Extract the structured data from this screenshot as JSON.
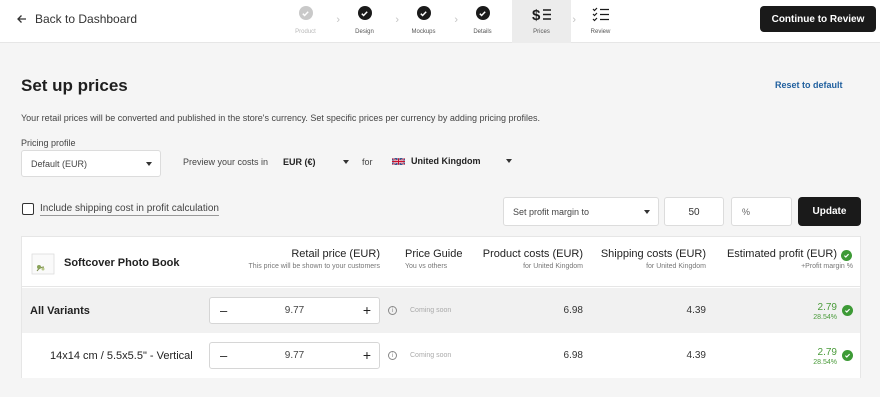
{
  "header": {
    "back_label": "Back to Dashboard",
    "continue_label": "Continue to Review",
    "steps": [
      {
        "label": "Product",
        "icon": "check-circle-icon",
        "state": "done-dim"
      },
      {
        "label": "Design",
        "icon": "check-circle-icon",
        "state": "done"
      },
      {
        "label": "Mockups",
        "icon": "check-circle-icon",
        "state": "done"
      },
      {
        "label": "Details",
        "icon": "check-circle-icon",
        "state": "done"
      },
      {
        "label": "Prices",
        "icon": "dollar-list-icon",
        "state": "active"
      },
      {
        "label": "Review",
        "icon": "checklist-icon",
        "state": "upcoming"
      }
    ]
  },
  "page": {
    "title": "Set up prices",
    "reset_label": "Reset to default",
    "description": "Your retail prices will be converted and published in the store's currency. Set specific prices per currency by adding pricing profiles."
  },
  "pricing": {
    "profile_label": "Pricing profile",
    "profile_value": "Default (EUR)",
    "preview_label": "Preview your costs in",
    "currency_value": "EUR (€)",
    "for_label": "for",
    "country_value": "United Kingdom"
  },
  "margin": {
    "include_shipping_label": "Include shipping cost in profit calculation",
    "mode_value": "Set profit margin to",
    "amount_value": "50",
    "unit_placeholder": "%",
    "update_label": "Update"
  },
  "table": {
    "product_name": "Softcover Photo Book",
    "columns": {
      "retail": {
        "title": "Retail price (EUR)",
        "sub": "This price will be shown to your customers"
      },
      "guide": {
        "title": "Price Guide",
        "sub": "You vs others"
      },
      "product_costs": {
        "title": "Product costs (EUR)",
        "sub": "for United Kingdom"
      },
      "shipping_costs": {
        "title": "Shipping costs (EUR)",
        "sub": "for United Kingdom"
      },
      "profit": {
        "title": "Estimated profit (EUR)",
        "sub": "+Profit margin %"
      }
    },
    "rows": [
      {
        "name": "All Variants",
        "retail": "9.77",
        "guide": "Coming soon",
        "product_cost": "6.98",
        "shipping_cost": "4.39",
        "profit": "2.79",
        "margin": "28.54%"
      },
      {
        "name": "14x14 cm / 5.5x5.5\" - Vertical",
        "retail": "9.77",
        "guide": "Coming soon",
        "product_cost": "6.98",
        "shipping_cost": "4.39",
        "profit": "2.79",
        "margin": "28.54%"
      }
    ],
    "stepper": {
      "minus": "–",
      "plus": "+"
    },
    "info_glyph": "i"
  },
  "colors": {
    "accent_dark": "#1a1a1a",
    "profit_green": "#3d9a36",
    "link_blue": "#1f5f9e"
  }
}
